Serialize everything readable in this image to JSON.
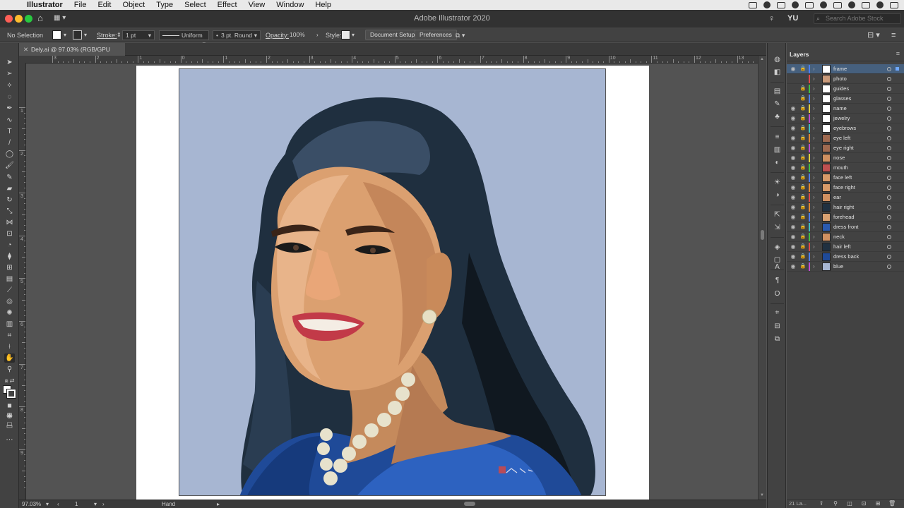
{
  "menubar": {
    "app": "Illustrator",
    "items": [
      "File",
      "Edit",
      "Object",
      "Type",
      "Select",
      "Effect",
      "View",
      "Window",
      "Help"
    ]
  },
  "window": {
    "title": "Adobe Illustrator 2020",
    "user": "YU",
    "search_placeholder": "Search Adobe Stock"
  },
  "control": {
    "selection": "No Selection",
    "stroke_label": "Stroke:",
    "stroke_value": "1 pt",
    "stroke_profile": "Uniform",
    "brush": "3 pt. Round",
    "opacity_label": "Opacity:",
    "opacity_value": "100%",
    "style_label": "Style:",
    "document_setup": "Document Setup",
    "preferences": "Preferences"
  },
  "document": {
    "tab": "Dely.ai @ 97.03% (RGB/GPU Preview)"
  },
  "ruler": {
    "h_labels": [
      "3",
      "2",
      "1",
      "0",
      "1",
      "2",
      "3",
      "4",
      "5",
      "6",
      "7",
      "8",
      "9",
      "10",
      "11",
      "12",
      "13"
    ],
    "v_labels": [
      "1",
      "2",
      "3",
      "4",
      "5",
      "6",
      "7",
      "8",
      "9"
    ]
  },
  "status": {
    "zoom": "97.03%",
    "artboard": "1",
    "tool": "Hand"
  },
  "layers": {
    "title": "Layers",
    "count": "21 La...",
    "items": [
      {
        "name": "frame",
        "color": "#4a7ff0",
        "thumb": "#ffffff",
        "visible": true,
        "locked": true
      },
      {
        "name": "photo",
        "color": "#e04848",
        "thumb": "#c99a7a",
        "visible": false,
        "locked": false
      },
      {
        "name": "guides",
        "color": "#40c040",
        "thumb": "#ffffff",
        "visible": false,
        "locked": true
      },
      {
        "name": "glasses",
        "color": "#4a7ff0",
        "thumb": "#ffffff",
        "visible": false,
        "locked": true
      },
      {
        "name": "name",
        "color": "#e0d040",
        "thumb": "#ffffff",
        "visible": true,
        "locked": true
      },
      {
        "name": "jewelry",
        "color": "#c04ad0",
        "thumb": "#ffffff",
        "visible": true,
        "locked": true
      },
      {
        "name": "eyebrows",
        "color": "#40c0c0",
        "thumb": "#ffffff",
        "visible": true,
        "locked": true
      },
      {
        "name": "eye left",
        "color": "#e08830",
        "thumb": "#a06a50",
        "visible": true,
        "locked": true
      },
      {
        "name": "eye right",
        "color": "#c04ad0",
        "thumb": "#a06a50",
        "visible": true,
        "locked": true
      },
      {
        "name": "nose",
        "color": "#e0d040",
        "thumb": "#d09060",
        "visible": true,
        "locked": true
      },
      {
        "name": "mouth",
        "color": "#40c040",
        "thumb": "#c05050",
        "visible": true,
        "locked": true
      },
      {
        "name": "face left",
        "color": "#4a7ff0",
        "thumb": "#d89a68",
        "visible": true,
        "locked": true
      },
      {
        "name": "face right",
        "color": "#e08830",
        "thumb": "#d89a68",
        "visible": true,
        "locked": true
      },
      {
        "name": "ear",
        "color": "#e04848",
        "thumb": "#d09060",
        "visible": true,
        "locked": true
      },
      {
        "name": "hair right",
        "color": "#e08830",
        "thumb": "#203040",
        "visible": true,
        "locked": true
      },
      {
        "name": "forehead",
        "color": "#4a7ff0",
        "thumb": "#d8a070",
        "visible": true,
        "locked": true
      },
      {
        "name": "dress front",
        "color": "#40c0c0",
        "thumb": "#2a5ab0",
        "visible": true,
        "locked": true
      },
      {
        "name": "neck",
        "color": "#40c040",
        "thumb": "#d09060",
        "visible": true,
        "locked": true
      },
      {
        "name": "hair left",
        "color": "#e04848",
        "thumb": "#203040",
        "visible": true,
        "locked": true
      },
      {
        "name": "dress back",
        "color": "#4a7ff0",
        "thumb": "#1f4a98",
        "visible": true,
        "locked": true
      },
      {
        "name": "blue",
        "color": "#c04ad0",
        "thumb": "#a7b6d2",
        "visible": true,
        "locked": true
      }
    ]
  }
}
